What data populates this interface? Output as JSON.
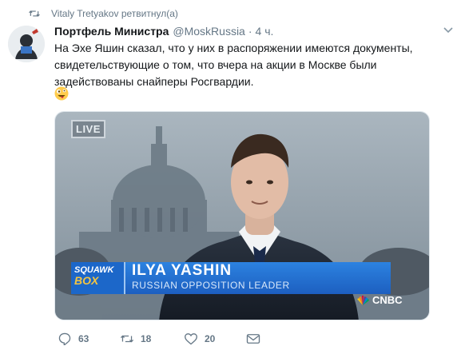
{
  "retweet_banner": {
    "text": "Vitaly Tretyakov ретвитнул(а)",
    "icon": "retweet-icon"
  },
  "tweet": {
    "author_name": "Портфель Министра",
    "author_handle": "@MoskRussia",
    "separator": "·",
    "time": "4 ч.",
    "text": "На Эхе Яшин сказал, что у них в распоряжении имеются документы, свидетельствующие о том, что вчера на акции в Москве были задействованы снайперы Росгвардии.",
    "emoji": "crazy-face-emoji"
  },
  "media": {
    "live_badge": "LIVE",
    "show_logo": {
      "line1": "SQUAWK",
      "line2": "BOX"
    },
    "lower_third": {
      "name": "ILYA YASHIN",
      "role": "RUSSIAN OPPOSITION LEADER"
    },
    "network": "CNBC"
  },
  "actions": {
    "reply": {
      "count": "63",
      "icon": "reply-icon"
    },
    "retweet": {
      "count": "18",
      "icon": "retweet-icon"
    },
    "like": {
      "count": "20",
      "icon": "heart-icon"
    },
    "dm": {
      "icon": "envelope-icon"
    }
  },
  "colors": {
    "secondary_text": "#657786",
    "primary_text": "#14171a",
    "cnbc_blue": "#1d5fc0"
  }
}
